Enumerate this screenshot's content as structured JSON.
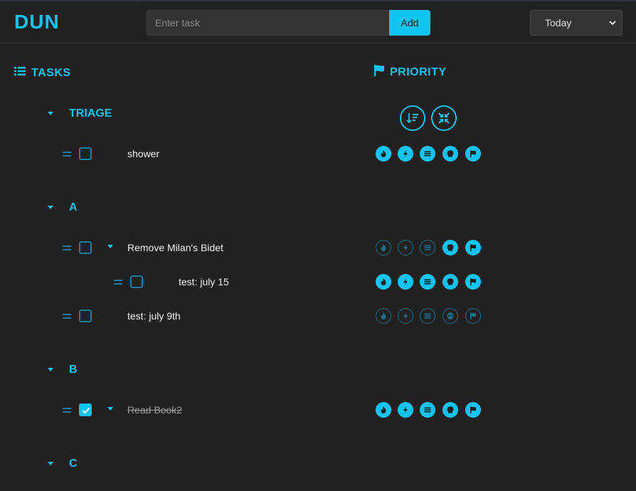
{
  "app": {
    "logo": "DUN"
  },
  "header": {
    "task_input": {
      "placeholder": "Enter task",
      "value": ""
    },
    "add_label": "Add",
    "day_select": {
      "selected": "Today"
    }
  },
  "columns": {
    "tasks_title": "TASKS",
    "priority_title": "PRIORITY"
  },
  "colors": {
    "accent": "#0fc4f0",
    "background": "#212121",
    "muted_accent": "#1a6f8b"
  },
  "priority_icons": [
    "fire-icon",
    "bolt-icon",
    "waves-icon",
    "skull-icon",
    "flag-icon"
  ],
  "groups": [
    {
      "name": "TRIAGE",
      "tasks": [
        {
          "label": "shower",
          "done": false,
          "priority_active": true
        }
      ]
    },
    {
      "name": "A",
      "tasks": [
        {
          "label": "Remove Milan's Bidet",
          "done": false,
          "priority_active": "skull-flag",
          "subtasks": [
            {
              "label": "test: july 15",
              "done": false,
              "priority_active": true
            }
          ]
        },
        {
          "label": "test: july 9th",
          "done": false,
          "priority_active": false
        }
      ]
    },
    {
      "name": "B",
      "tasks": [
        {
          "label": "Read Book2",
          "done": true,
          "priority_active": true
        }
      ]
    },
    {
      "name": "C",
      "tasks": []
    }
  ]
}
